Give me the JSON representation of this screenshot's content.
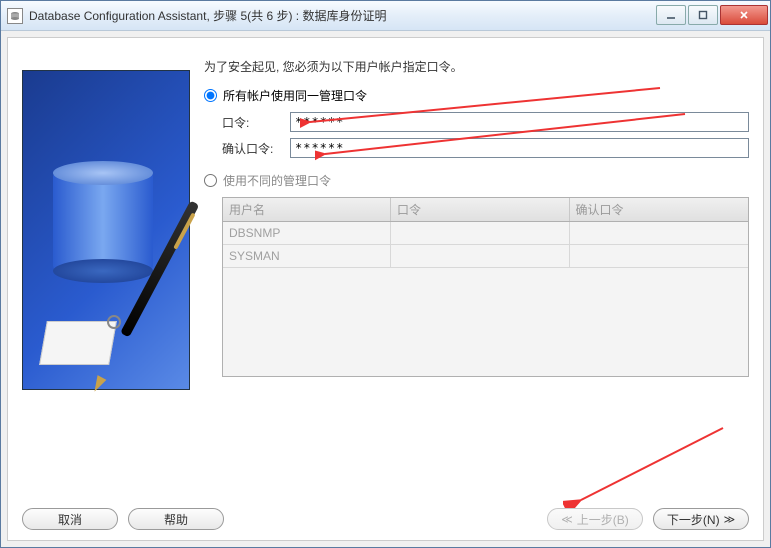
{
  "window": {
    "title": "Database Configuration Assistant, 步骤 5(共 6 步) : 数据库身份证明"
  },
  "instruction": "为了安全起见, 您必须为以下用户帐户指定口令。",
  "options": {
    "same": {
      "label": "所有帐户使用同一管理口令",
      "selected": true
    },
    "diff": {
      "label": "使用不同的管理口令",
      "selected": false
    }
  },
  "fields": {
    "password": {
      "label": "口令:",
      "value": "******"
    },
    "confirm": {
      "label": "确认口令:",
      "value": "******"
    }
  },
  "table": {
    "headers": {
      "user": "用户名",
      "pass": "口令",
      "confirm": "确认口令"
    },
    "rows": [
      {
        "user": "DBSNMP",
        "pass": "",
        "confirm": ""
      },
      {
        "user": "SYSMAN",
        "pass": "",
        "confirm": ""
      }
    ]
  },
  "buttons": {
    "cancel": "取消",
    "help": "帮助",
    "back": "上一步(B)",
    "next": "下一步(N)"
  }
}
